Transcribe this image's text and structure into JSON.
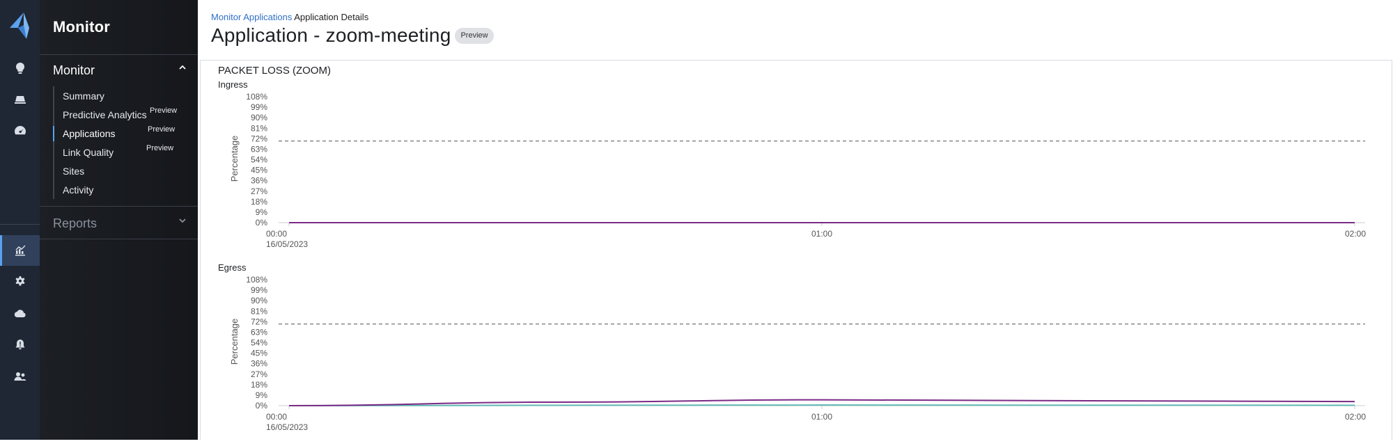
{
  "nav": {
    "title": "Monitor",
    "sections": [
      {
        "label": "Monitor",
        "items": [
          {
            "label": "Summary",
            "tag": ""
          },
          {
            "label": "Predictive Analytics",
            "tag": "Preview"
          },
          {
            "label": "Applications",
            "tag": "Preview"
          },
          {
            "label": "Link Quality",
            "tag": "Preview"
          },
          {
            "label": "Sites",
            "tag": ""
          },
          {
            "label": "Activity",
            "tag": ""
          }
        ]
      },
      {
        "label": "Reports",
        "items": []
      }
    ]
  },
  "rail": {
    "icons": [
      "logo-icon",
      "lightbulb-icon",
      "device-icon",
      "dashboard-gauge-icon",
      "analytics-chart-icon",
      "gear-icon",
      "cloud-icon",
      "alert-bell-icon",
      "users-icon"
    ],
    "active": "analytics-chart-icon"
  },
  "breadcrumb": {
    "link": "Monitor Applications",
    "current": "Application Details"
  },
  "page": {
    "title": "Application - zoom-meeting",
    "badge": "Preview"
  },
  "panel_title": "PACKET LOSS (ZOOM)",
  "colors": {
    "accent": "#5aa2ee",
    "link": "#2f72c7",
    "series_purple": "#7a2a86",
    "series_teal": "#5fb7b3",
    "threshold": "#555555"
  },
  "chart_data": [
    {
      "type": "line",
      "title": "Ingress",
      "ylabel": "Percentage",
      "ylim": [
        0,
        108
      ],
      "yticks": [
        "108%",
        "99%",
        "90%",
        "81%",
        "72%",
        "63%",
        "54%",
        "45%",
        "36%",
        "27%",
        "18%",
        "9%",
        "0%"
      ],
      "xticks": [
        "00:00",
        "01:00",
        "02:00"
      ],
      "xsub": "16/05/2023",
      "threshold": 70,
      "series": [
        {
          "color": "#7a2a86",
          "x": [
            0,
            0.5,
            1,
            1.5,
            2
          ],
          "values": [
            0,
            0,
            0,
            0,
            0
          ]
        },
        {
          "color": "#5fb7b3",
          "x": [
            0,
            0.5,
            1,
            1.5,
            2
          ],
          "values": [
            0,
            0,
            0,
            0,
            0
          ]
        }
      ]
    },
    {
      "type": "line",
      "title": "Egress",
      "ylabel": "Percentage",
      "ylim": [
        0,
        108
      ],
      "yticks": [
        "108%",
        "99%",
        "90%",
        "81%",
        "72%",
        "63%",
        "54%",
        "45%",
        "36%",
        "27%",
        "18%",
        "9%",
        "0%"
      ],
      "xticks": [
        "00:00",
        "01:00",
        "02:00"
      ],
      "xsub": "16/05/2023",
      "threshold": 70,
      "series": [
        {
          "color": "#7a2a86",
          "x": [
            0,
            0.5,
            1,
            1.5,
            2
          ],
          "values": [
            0,
            3,
            5,
            4.2,
            3.5
          ]
        },
        {
          "color": "#5fb7b3",
          "x": [
            0,
            0.5,
            1,
            1.5,
            2
          ],
          "values": [
            0,
            0.3,
            0.5,
            0.4,
            0.3
          ]
        }
      ]
    }
  ]
}
